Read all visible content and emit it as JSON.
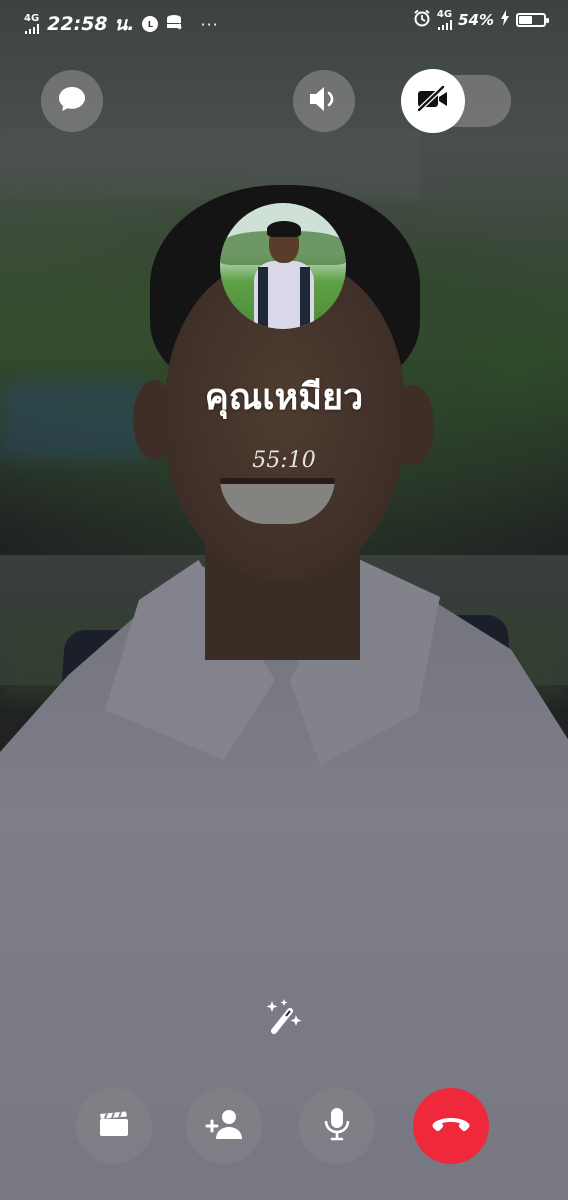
{
  "status_bar": {
    "network_left": "4G",
    "time": "22:58 น.",
    "more": "···",
    "network_right": "4G",
    "battery_percent": "54%",
    "battery_level": 0.54,
    "icons": [
      "signal-icon",
      "line-app-icon",
      "data-saver-icon",
      "alarm-icon",
      "charging-icon",
      "battery-icon"
    ]
  },
  "top_controls": {
    "chat": "chat-bubble-icon",
    "speaker": "speaker-icon",
    "video": {
      "icon": "video-off-icon",
      "state": "off"
    }
  },
  "call": {
    "caller_name": "คุณเหมียว",
    "duration": "55:10"
  },
  "effects": {
    "icon": "sparkle-wand-icon"
  },
  "bottom_controls": {
    "buttons": [
      "clapperboard-icon",
      "add-person-icon",
      "microphone-icon",
      "end-call-icon"
    ],
    "end_call_color": "#f0283c"
  }
}
